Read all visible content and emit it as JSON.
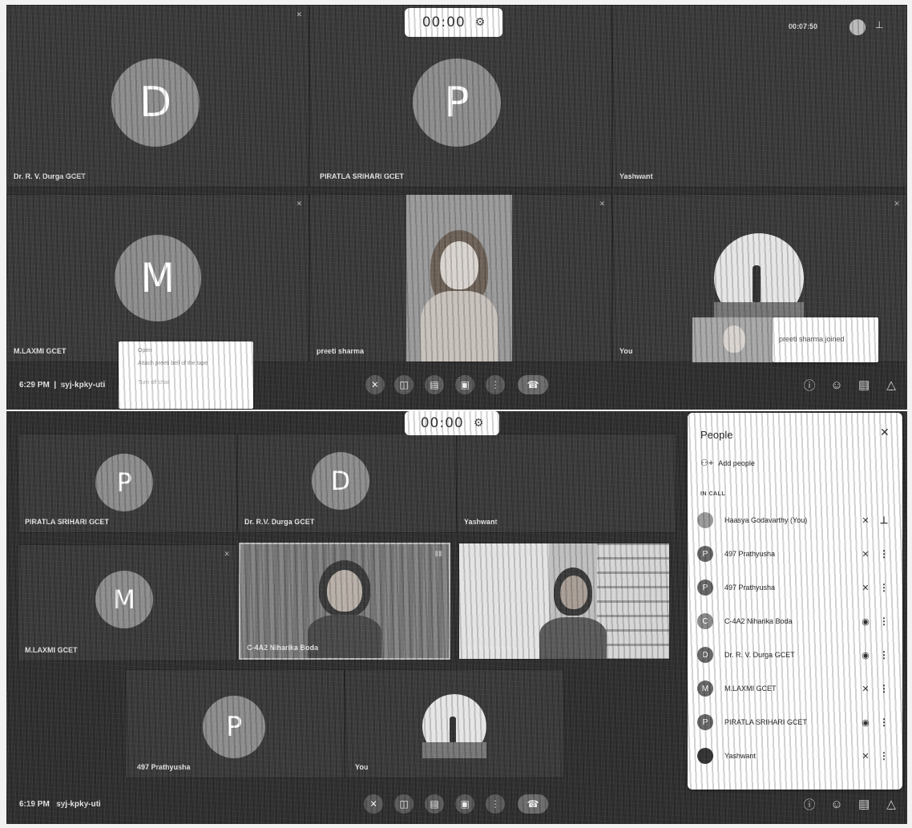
{
  "top": {
    "timer": "00:00",
    "recording_time": "00:07:50",
    "clock": "6:29 PM",
    "meeting_code": "syj-kpky-uti",
    "tiles": [
      {
        "initial": "D",
        "name": "Dr. R. V. Durga GCET"
      },
      {
        "initial": "P",
        "name": "PIRATLA SRIHARI GCET"
      },
      {
        "initial": "",
        "name": "Yashwant"
      },
      {
        "initial": "M",
        "name": "M.LAXMI GCET"
      },
      {
        "initial": "",
        "name": "preeti sharma"
      },
      {
        "initial": "",
        "name": "You"
      }
    ],
    "toast": "preeti sharma joined",
    "popup_lines": [
      "Open",
      "Attach preeti bell of the tape",
      "Turn off chat"
    ]
  },
  "bottom": {
    "timer": "00:00",
    "clock": "6:19 PM",
    "meeting_code": "syj-kpky-uti",
    "tiles": [
      {
        "initial": "P",
        "name": "PIRATLA SRIHARI GCET"
      },
      {
        "initial": "D",
        "name": "Dr. R.V. Durga GCET"
      },
      {
        "initial": "",
        "name": "Yashwant"
      },
      {
        "initial": "M",
        "name": "M.LAXMI GCET"
      },
      {
        "initial": "",
        "name": "C-4A2 Niharika Boda"
      },
      {
        "initial": "",
        "name": "497 Prathyusha"
      },
      {
        "initial": "P",
        "name": "497 Prathyusha"
      },
      {
        "initial": "",
        "name": "You"
      }
    ]
  },
  "people_panel": {
    "title": "People",
    "close_icon": "✕",
    "add_people": "Add people",
    "section": "IN CALL",
    "participants": [
      {
        "initial": "",
        "name": "Haasya Godavarthy (You)",
        "status": "mic-off",
        "action": "pin"
      },
      {
        "initial": "P",
        "name": "497 Prathyusha",
        "status": "mic-off",
        "action": "more"
      },
      {
        "initial": "P",
        "name": "497 Prathyusha",
        "status": "mic-off",
        "action": "more"
      },
      {
        "initial": "C",
        "name": "C-4A2 Niharika Boda",
        "status": "speaking",
        "action": "more"
      },
      {
        "initial": "D",
        "name": "Dr. R. V. Durga GCET",
        "status": "speaking",
        "action": "more"
      },
      {
        "initial": "M",
        "name": "M.LAXMI GCET",
        "status": "mic-off",
        "action": "more"
      },
      {
        "initial": "P",
        "name": "PIRATLA SRIHARI GCET",
        "status": "speaking",
        "action": "more"
      },
      {
        "initial": "",
        "name": "Yashwant",
        "status": "mic-off",
        "action": "more"
      }
    ]
  }
}
